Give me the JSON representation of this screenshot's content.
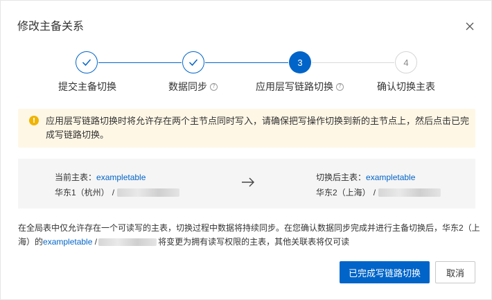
{
  "dialog": {
    "title": "修改主备关系",
    "close_icon": "close-icon"
  },
  "steps": [
    {
      "label": "提交主备切换",
      "status": "done",
      "icon": "check-icon"
    },
    {
      "label": "数据同步",
      "status": "done",
      "icon": "check-icon",
      "help": true
    },
    {
      "number": "3",
      "label": "应用层写链路切换",
      "status": "active",
      "help": true
    },
    {
      "number": "4",
      "label": "确认切换主表",
      "status": "todo"
    }
  ],
  "alert": {
    "icon": "warning-icon",
    "text": "应用层写链路切换时将允许存在两个主节点同时写入，请确保把写操作切换到新的主节点上，然后点击已完成写链路切换。"
  },
  "compare": {
    "current": {
      "label": "当前主表：",
      "table": "exampletable",
      "region": "华东1（杭州）",
      "sep": "/"
    },
    "after": {
      "label": "切换后主表：",
      "table": "exampletable",
      "region": "华东2（上海）",
      "sep": "/"
    }
  },
  "note": {
    "part1": "在全局表中仅允许存在一个可读写的主表，切换过程中数据将持续同步。在您确认数据同步完成并进行主备切换后，华东2（上海）的",
    "table": "exampletable",
    "sep": "/",
    "part2": "将变更为拥有读写权限的主表，其他关联表将仅可读"
  },
  "buttons": {
    "primary": "已完成写链路切换",
    "cancel": "取消"
  },
  "colors": {
    "primary": "#0064c8",
    "warning": "#f0b400",
    "alert_bg": "#fff7e6"
  }
}
